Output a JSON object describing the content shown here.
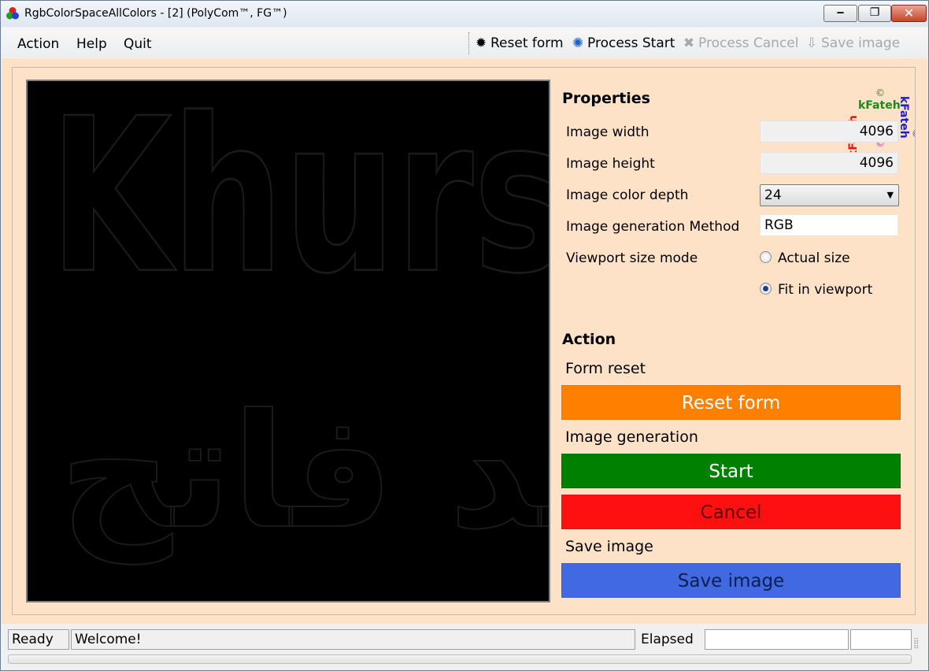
{
  "window": {
    "title": "RgbColorSpaceAllColors - [2] (PolyCom™, FG™)",
    "minimize_glyph": "‒",
    "maximize_glyph": "❐",
    "close_glyph": "✕"
  },
  "menu": {
    "items": [
      "Action",
      "Help",
      "Quit"
    ]
  },
  "toolbar": {
    "reset_form": "Reset form",
    "process_start": "Process Start",
    "process_cancel": "Process Cancel",
    "save_image": "Save image"
  },
  "watermark": {
    "latin": "Khursheed Fateh",
    "arabic": "خورشيد فاتح"
  },
  "logo": {
    "text": "kFateh",
    "symbol": "©",
    "colors": [
      "#1a8a1a",
      "#2222cc",
      "#cc22cc",
      "#ee1111"
    ]
  },
  "properties": {
    "title": "Properties",
    "image_width_label": "Image width",
    "image_width_value": "4096",
    "image_height_label": "Image height",
    "image_height_value": "4096",
    "color_depth_label": "Image color depth",
    "color_depth_value": "24",
    "gen_method_label": "Image generation Method",
    "gen_method_value": "RGB",
    "viewport_mode_label": "Viewport size mode",
    "viewport_mode_options": [
      "Actual size",
      "Fit in viewport"
    ],
    "viewport_mode_selected": "Fit in viewport"
  },
  "actions": {
    "title": "Action",
    "form_reset_label": "Form reset",
    "reset_button": "Reset form",
    "image_generation_label": "Image generation",
    "start_button": "Start",
    "cancel_button": "Cancel",
    "save_image_label": "Save image",
    "save_button": "Save image"
  },
  "colors": {
    "panel_bg": "#fde2c7",
    "reset_bg": "#ff8000",
    "start_bg": "#008000",
    "cancel_bg": "#ff1010",
    "save_bg": "#4169e1"
  },
  "statusbar": {
    "status": "Ready",
    "message": "Welcome!",
    "elapsed_label": "Elapsed",
    "elapsed_value": "",
    "extra": ""
  }
}
